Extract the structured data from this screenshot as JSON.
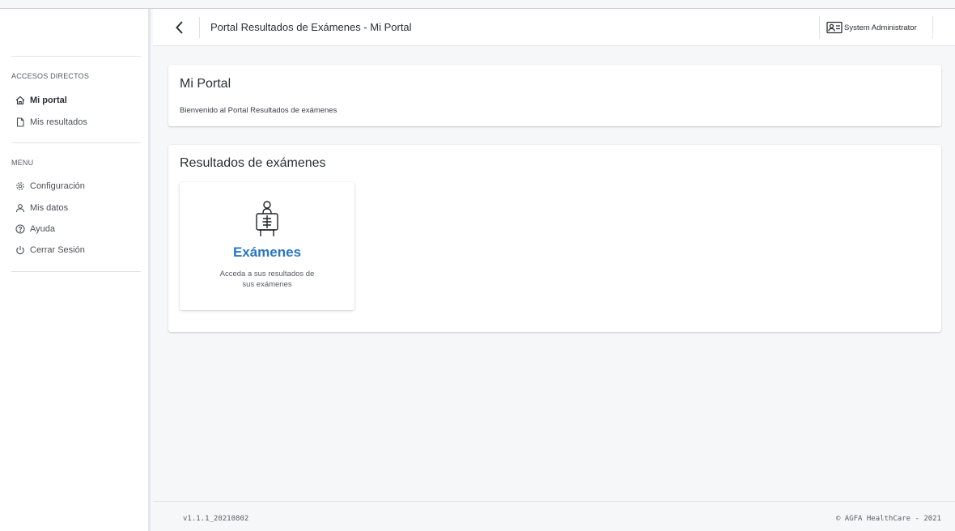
{
  "header": {
    "title": "Portal Resultados de Exámenes - Mi Portal",
    "user_name": "System Administrator",
    "icons": {
      "back": "chevron-left-icon",
      "user": "id-card-icon"
    }
  },
  "sidebar": {
    "shortcuts_heading": "ACCESOS DIRECTOS",
    "shortcuts": [
      {
        "label": "Mi portal",
        "icon": "home-icon",
        "active": true
      },
      {
        "label": "Mis resultados",
        "icon": "file-icon",
        "active": false
      }
    ],
    "menu_heading": "MENU",
    "menu": [
      {
        "label": "Configuración",
        "icon": "gear-icon"
      },
      {
        "label": "Mis datos",
        "icon": "user-icon"
      },
      {
        "label": "Ayuda",
        "icon": "help-circle-icon"
      },
      {
        "label": "Cerrar Sesión",
        "icon": "power-icon"
      }
    ]
  },
  "main": {
    "welcome_card": {
      "title": "Mi Portal",
      "subtitle": "Bienvenido al Portal Resultados de exámenes"
    },
    "results_card": {
      "title": "Resultados de exámenes",
      "tiles": [
        {
          "title": "Exámenes",
          "description": "Acceda a sus resultados de sus exámenes",
          "icon": "xray-icon"
        }
      ]
    }
  },
  "footer": {
    "version": "v1.1.1_20210802",
    "copyright": "© AGFA HealthCare - 2021"
  },
  "colors": {
    "accent": "#2a75c2",
    "background": "#f6f7f9",
    "surface": "#ffffff"
  }
}
